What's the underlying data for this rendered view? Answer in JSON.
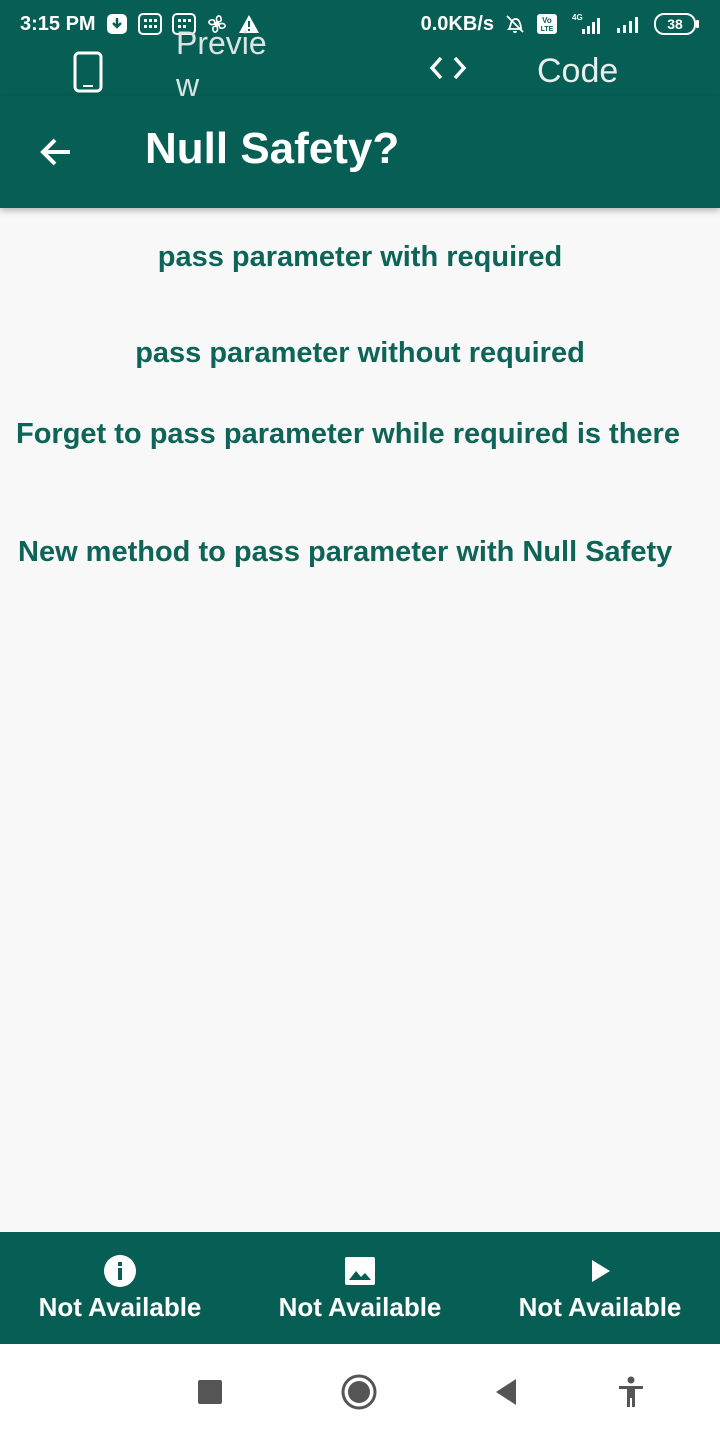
{
  "status_bar": {
    "time": "3:15 PM",
    "network_speed": "0.0KB/s",
    "battery": "38",
    "icons": [
      "download-icon",
      "app-grid-icon",
      "app-grid-icon",
      "fan-icon",
      "warning-icon",
      "alarm-off-icon",
      "volte-icon",
      "signal-4g-icon",
      "signal-icon",
      "battery-icon"
    ]
  },
  "tabs": {
    "preview_label": "Previe w",
    "code_label": "Code",
    "icons": [
      "phone-icon",
      "code-icon"
    ]
  },
  "app_bar": {
    "title": "Null Safety?",
    "back_icon": "arrow-back-icon"
  },
  "items": [
    "pass parameter with required",
    "pass parameter without required",
    "Forget to pass parameter while required is there",
    "New method to pass parameter with Null Safety"
  ],
  "bottom_nav": [
    {
      "label": "Not Available",
      "icon": "info-icon"
    },
    {
      "label": "Not Available",
      "icon": "image-icon"
    },
    {
      "label": "Not Available",
      "icon": "play-icon"
    }
  ],
  "colors": {
    "primary": "#075e54",
    "text_accent": "#0d6457",
    "background": "#f8f8f8"
  },
  "system_nav": [
    "recents-icon",
    "home-icon",
    "back-icon",
    "accessibility-icon"
  ]
}
